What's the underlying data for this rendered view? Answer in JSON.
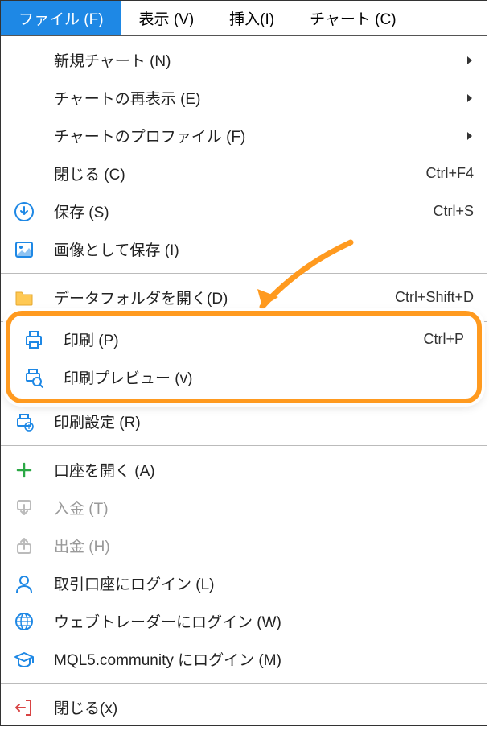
{
  "menubar": {
    "items": [
      {
        "label": "ファイル (F)",
        "active": true
      },
      {
        "label": "表示 (V)",
        "active": false
      },
      {
        "label": "挿入(I)",
        "active": false
      },
      {
        "label": "チャート (C)",
        "active": false
      }
    ]
  },
  "menu": {
    "groups": [
      [
        {
          "icon": "",
          "label": "新規チャート (N)",
          "submenu": true
        },
        {
          "icon": "",
          "label": "チャートの再表示 (E)",
          "submenu": true
        },
        {
          "icon": "",
          "label": "チャートのプロファイル (F)",
          "submenu": true
        },
        {
          "icon": "",
          "label": "閉じる (C)",
          "shortcut": "Ctrl+F4"
        },
        {
          "icon": "save",
          "label": "保存 (S)",
          "shortcut": "Ctrl+S"
        },
        {
          "icon": "image",
          "label": "画像として保存 (I)"
        }
      ],
      [
        {
          "icon": "folder",
          "label": "データフォルダを開く(D)",
          "shortcut": "Ctrl+Shift+D"
        }
      ],
      [
        {
          "icon": "print",
          "label": "印刷 (P)",
          "shortcut": "Ctrl+P",
          "highlighted": true
        },
        {
          "icon": "preview",
          "label": "印刷プレビュー (v)",
          "highlighted": true
        },
        {
          "icon": "print-setup",
          "label": "印刷設定 (R)"
        }
      ],
      [
        {
          "icon": "plus",
          "label": "口座を開く (A)"
        },
        {
          "icon": "deposit",
          "label": "入金 (T)",
          "disabled": true
        },
        {
          "icon": "withdraw",
          "label": "出金 (H)",
          "disabled": true
        },
        {
          "icon": "user",
          "label": "取引口座にログイン (L)"
        },
        {
          "icon": "globe",
          "label": "ウェブトレーダーにログイン (W)"
        },
        {
          "icon": "graduate",
          "label": "MQL5.community にログイン (M)"
        }
      ],
      [
        {
          "icon": "exit",
          "label": "閉じる(x)"
        }
      ]
    ]
  }
}
